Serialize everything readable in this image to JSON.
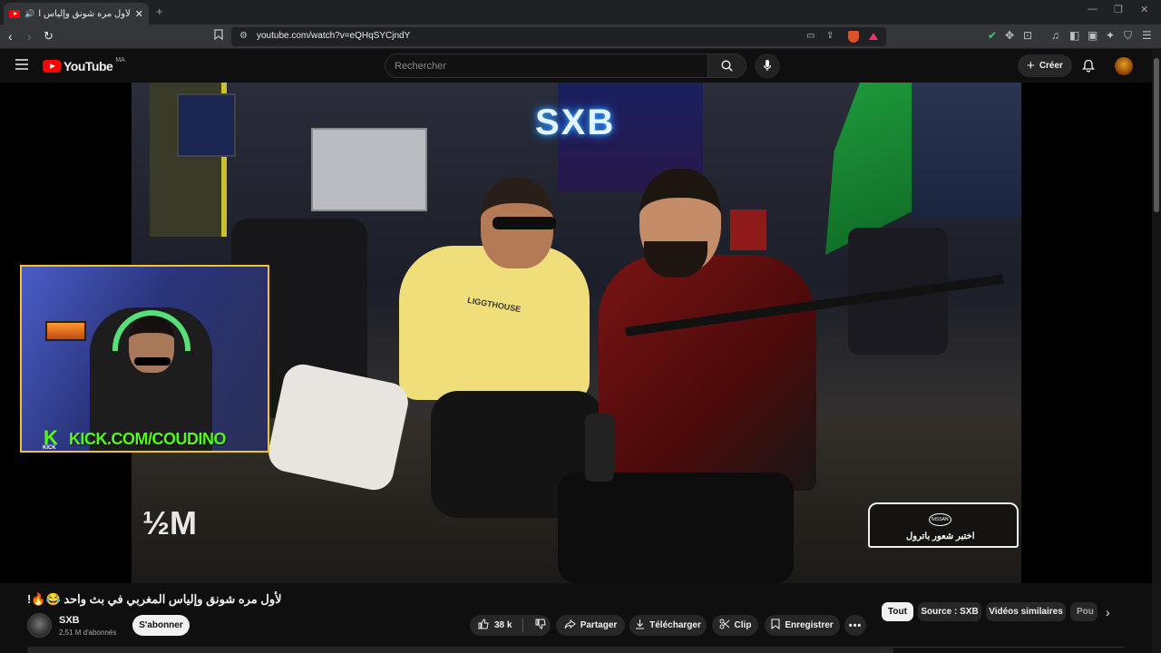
{
  "browser": {
    "tab_title": "لأول مره شونق وإلياس المغربي",
    "new_tab_icon": "plus-icon",
    "url": "youtube.com/watch?v=eQHqSYCjndY"
  },
  "youtube": {
    "logo_text": "YouTube",
    "region": "MA",
    "search_placeholder": "Rechercher",
    "create_label": "Créer"
  },
  "video": {
    "overlay_url": "KICK.COM/COUDINO",
    "overlay_badge": "KICK",
    "overlay_k": "K",
    "subs_overlay": "½M",
    "scene_logo": "SXB",
    "shirt_text": "LIGGTHOUSE",
    "sponsor_text": "اختبر شعور باترول",
    "sponsor_brand": "NISSAN"
  },
  "below": {
    "title": "لأول مره شونق وإلياس المغربي في بث واحد 😂🔥!",
    "channel_name": "SXB",
    "subscribers": "2,51 M d'abonnés",
    "subscribe_label": "S'abonner",
    "likes": "38 k",
    "share_label": "Partager",
    "download_label": "Télécharger",
    "clip_label": "Clip",
    "save_label": "Enregistrer",
    "chips": [
      "Tout",
      "Source : SXB",
      "Vidéos similaires",
      "Pou"
    ]
  },
  "colors": {
    "accent": "#ff0000",
    "webcam_border": "#f2c230",
    "kick_green": "#53fc18"
  }
}
